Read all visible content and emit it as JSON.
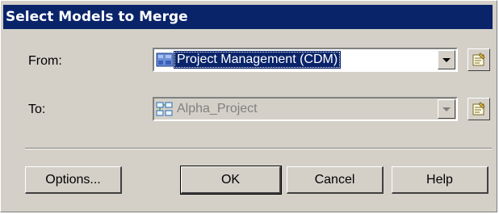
{
  "dialog": {
    "title": "Select Models to Merge"
  },
  "from": {
    "label": "From:",
    "value": "Project Management (CDM)",
    "icon": "cdm-model-icon"
  },
  "to": {
    "label": "To:",
    "value": "Alpha_Project",
    "icon": "project-model-icon",
    "disabled": true
  },
  "buttons": {
    "options": "Options...",
    "ok": "OK",
    "cancel": "Cancel",
    "help": "Help"
  },
  "colors": {
    "title_bar": "#0a246a",
    "dialog_bg": "#d4d0c8",
    "selection": "#0a246a"
  }
}
